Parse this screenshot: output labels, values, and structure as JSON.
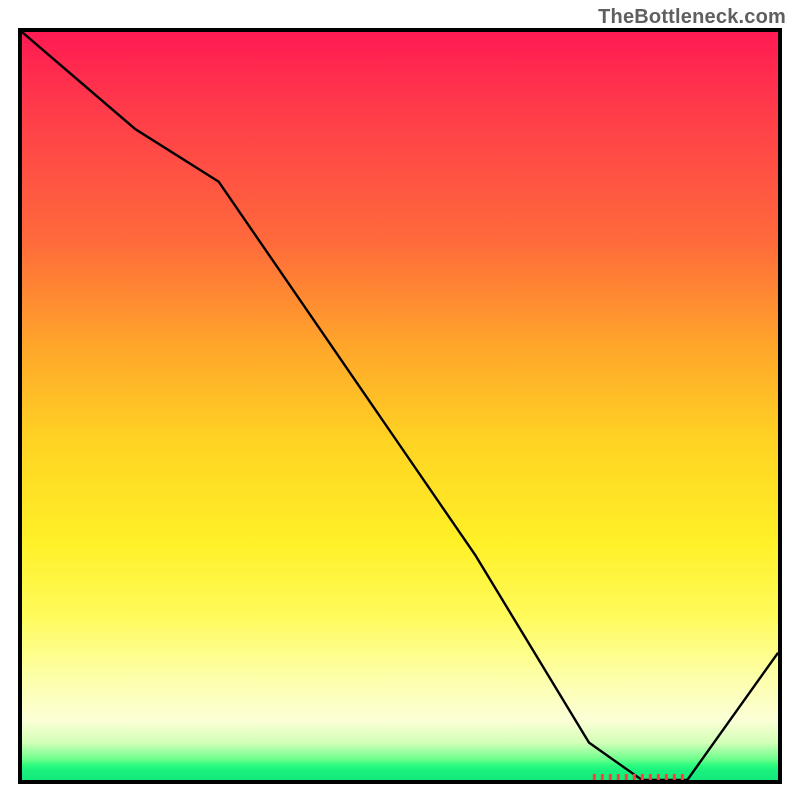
{
  "attribution": "TheBottleneck.com",
  "chart_data": {
    "type": "line",
    "title": "",
    "xlabel": "",
    "ylabel": "",
    "xlim": [
      0,
      100
    ],
    "ylim": [
      0,
      100
    ],
    "x": [
      0,
      15,
      26,
      60,
      75,
      82,
      88,
      100
    ],
    "values": [
      100,
      87,
      80,
      30,
      5,
      0,
      0,
      17
    ],
    "marker": {
      "x_start": 75.5,
      "x_end": 88,
      "y": 0
    },
    "background_gradient": {
      "top_color": "#ff1a53",
      "mid_color": "#fff027",
      "bottom_band_color": "#14ea7c"
    }
  }
}
